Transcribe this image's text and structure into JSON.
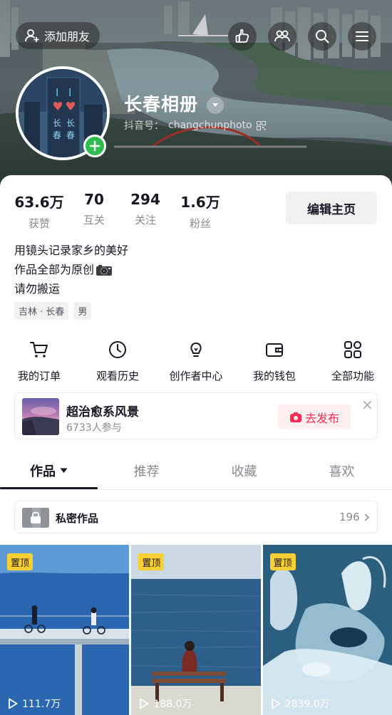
{
  "header": {
    "add_friends_label": "添加朋友",
    "actions": [
      {
        "name": "hand-icon"
      },
      {
        "name": "friends-icon"
      },
      {
        "name": "search-icon"
      },
      {
        "name": "menu-icon"
      }
    ]
  },
  "profile": {
    "name": "长春相册",
    "douyin_id_label": "抖音号：",
    "douyin_id": "changchunphoto",
    "avatar_text": [
      "I",
      "I",
      "长",
      "长",
      "春",
      "春"
    ]
  },
  "stats": [
    {
      "value": "63.6万",
      "label": "获赞"
    },
    {
      "value": "70",
      "label": "互关"
    },
    {
      "value": "294",
      "label": "关注"
    },
    {
      "value": "1.6万",
      "label": "粉丝"
    }
  ],
  "edit_button": "编辑主页",
  "bio": [
    "用镜头记录家乡的美好",
    "作品全部为原创",
    "请勿搬运"
  ],
  "tags": [
    "吉林 · 长春",
    "男"
  ],
  "quick_actions": [
    {
      "label": "我的订单",
      "icon": "cart-icon"
    },
    {
      "label": "观看历史",
      "icon": "clock-icon"
    },
    {
      "label": "创作者中心",
      "icon": "bulb-icon"
    },
    {
      "label": "我的钱包",
      "icon": "wallet-icon"
    },
    {
      "label": "全部功能",
      "icon": "grid-icon"
    }
  ],
  "promo": {
    "title": "超治愈系风景",
    "subtitle": "6733人参与",
    "button": "去发布",
    "close": "×"
  },
  "tabs": [
    {
      "label": "作品",
      "active": true
    },
    {
      "label": "推荐",
      "active": false
    },
    {
      "label": "收藏",
      "active": false
    },
    {
      "label": "喜欢",
      "active": false
    }
  ],
  "private_works": {
    "label": "私密作品",
    "count": "196"
  },
  "videos": [
    {
      "pinned": "置顶",
      "plays": "111.7万"
    },
    {
      "pinned": "置顶",
      "plays": "188.0万"
    },
    {
      "pinned": "置顶",
      "plays": "2839.0万"
    }
  ],
  "colors": {
    "accent": "#fe2c55",
    "pin": "#facf33",
    "plus": "#2fbd4e"
  }
}
